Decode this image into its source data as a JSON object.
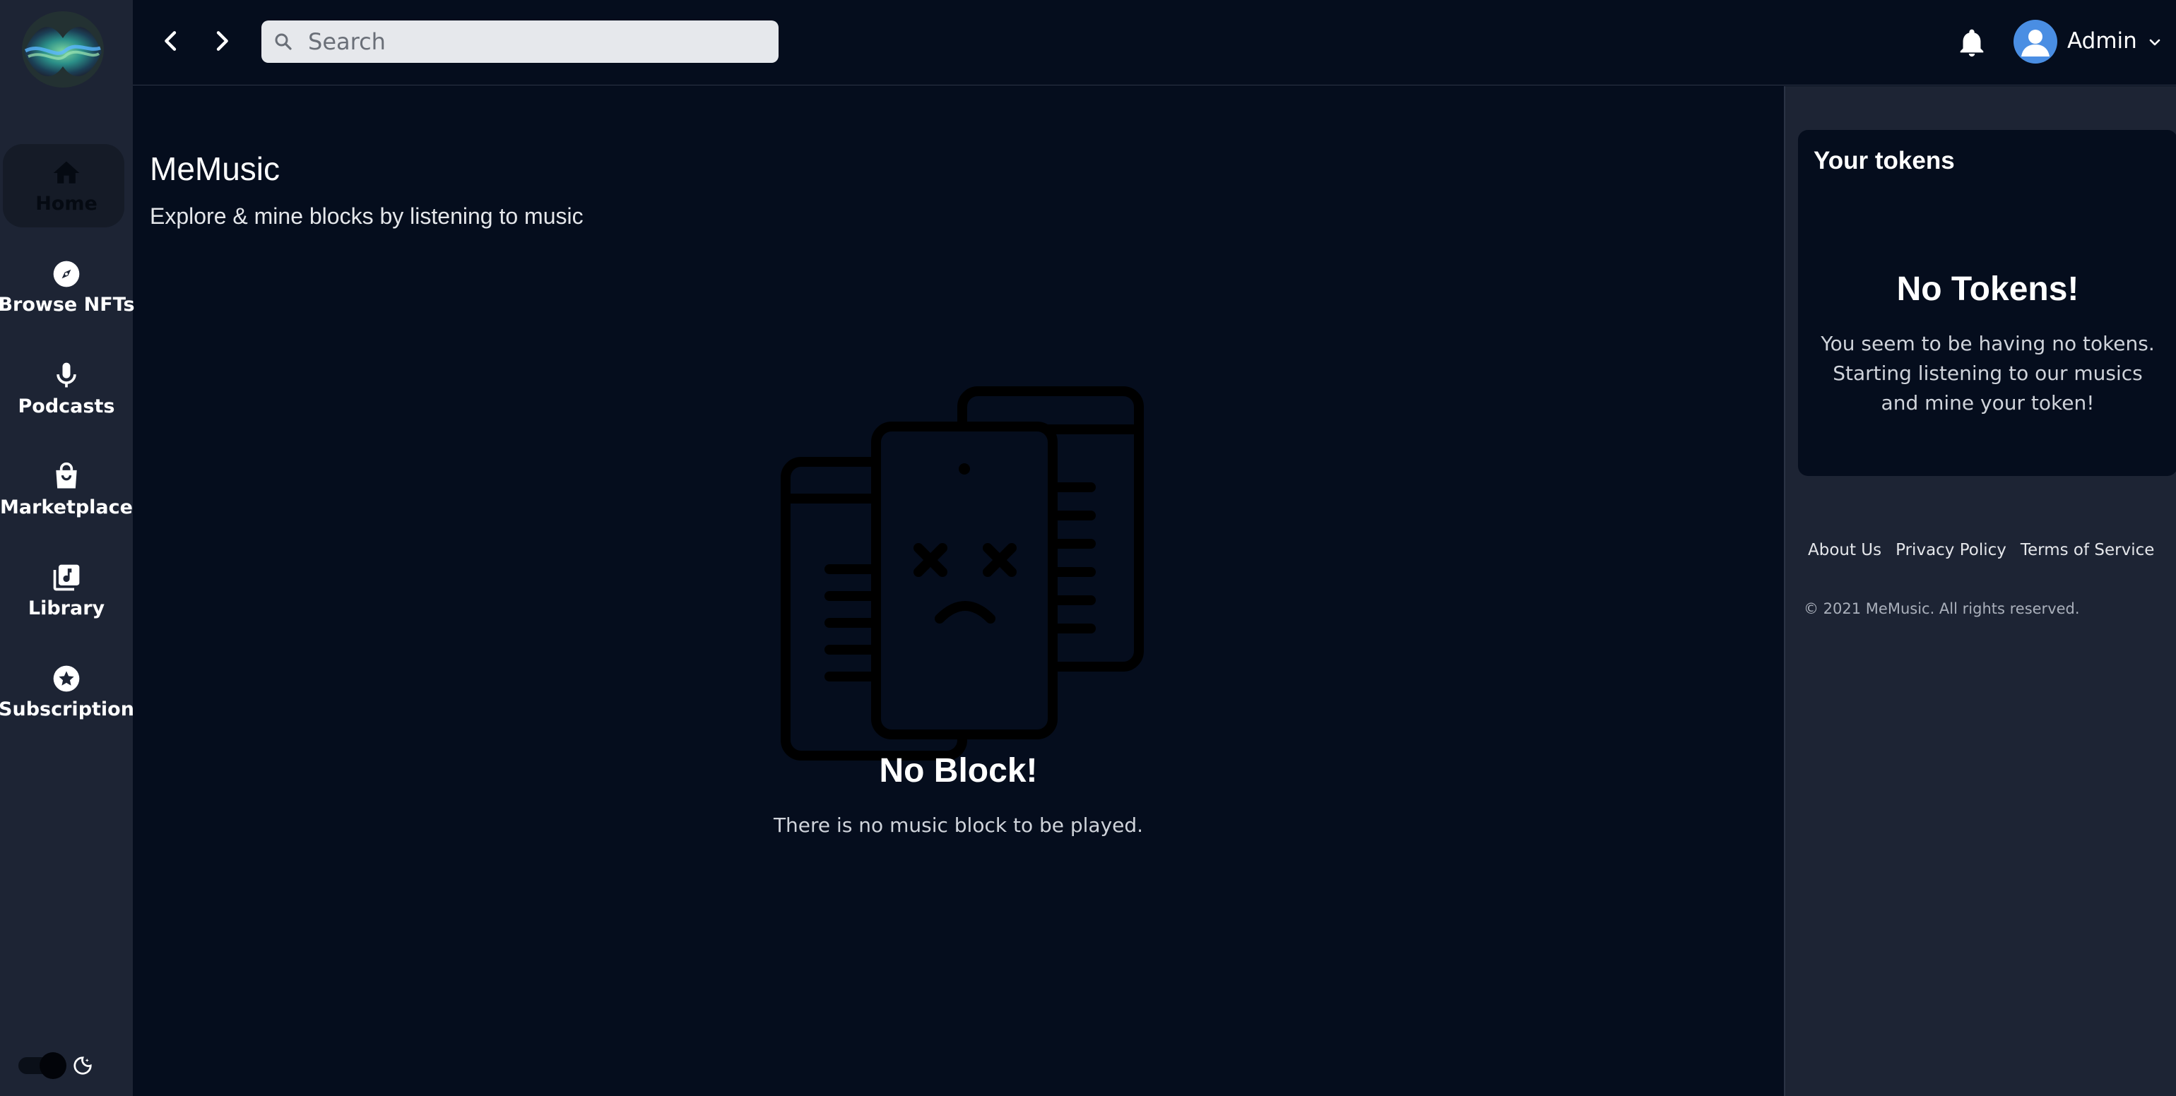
{
  "app": {
    "name": "MeMusic"
  },
  "sidebar": {
    "items": [
      {
        "label": "Home",
        "icon": "home-icon",
        "active": true
      },
      {
        "label": "Browse NFTs",
        "icon": "compass-icon",
        "active": false
      },
      {
        "label": "Podcasts",
        "icon": "microphone-icon",
        "active": false
      },
      {
        "label": "Marketplace",
        "icon": "shopping-bag-icon",
        "active": false
      },
      {
        "label": "Library",
        "icon": "music-library-icon",
        "active": false
      },
      {
        "label": "Subscription",
        "icon": "star-icon",
        "active": false
      }
    ],
    "theme_toggle": {
      "mode": "dark",
      "icon": "moon-icon"
    }
  },
  "topbar": {
    "back_icon": "chevron-left-icon",
    "forward_icon": "chevron-right-icon",
    "search": {
      "placeholder": "Search",
      "value": ""
    },
    "notifications_icon": "bell-icon",
    "user": {
      "name": "Admin",
      "avatar_icon": "user-avatar-icon",
      "menu_icon": "chevron-down-icon"
    }
  },
  "main": {
    "title": "MeMusic",
    "subtitle": "Explore & mine blocks by listening to music",
    "empty_state": {
      "illustration": "sad-documents-icon",
      "title": "No Block!",
      "text": "There is no music block to be played."
    }
  },
  "right_panel": {
    "card_title": "Your tokens",
    "empty_title": "No Tokens!",
    "empty_text": "You seem to be having no tokens. Starting listening to our musics and mine your token!",
    "footer_links": [
      "About Us",
      "Privacy Policy",
      "Terms of Service"
    ],
    "copyright": "© 2021 MeMusic. All rights reserved."
  },
  "colors": {
    "background": "#050d1d",
    "sidebar": "#1d2434",
    "search_bg": "#e6e8ec",
    "avatar": "#4a8ee3"
  }
}
